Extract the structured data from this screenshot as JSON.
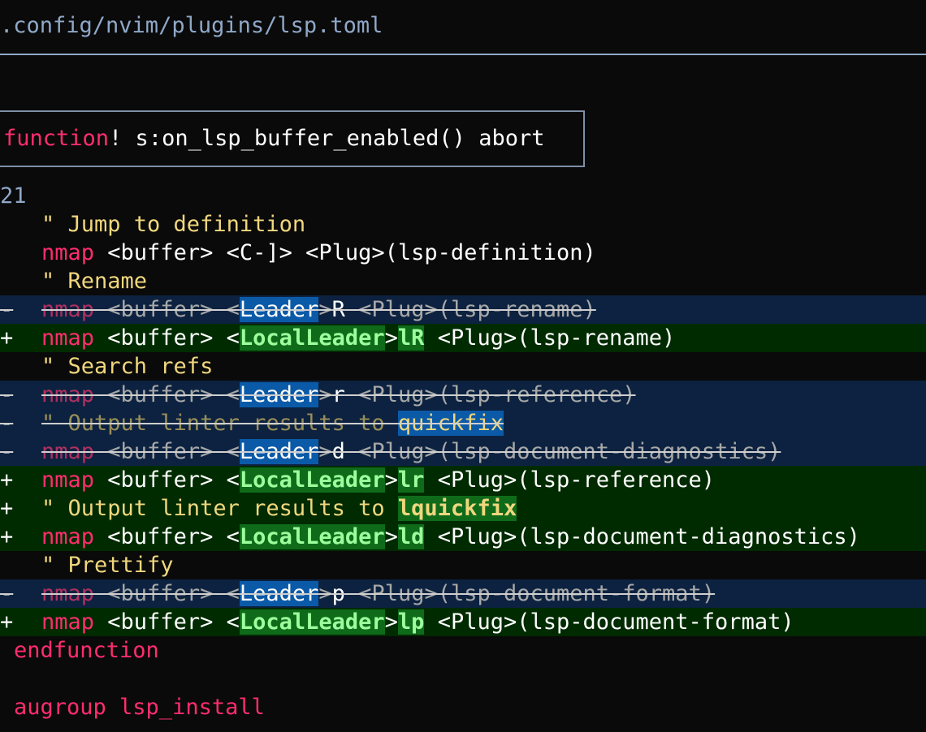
{
  "file_path": ".config/nvim/plugins/lsp.toml",
  "hunk": {
    "keyword": "function",
    "rest": "! s:on_lsp_buffer_enabled() abort"
  },
  "line_number": "21",
  "lines": {
    "l1": {
      "text": "\" Jump to definition"
    },
    "l2": {
      "kw": "nmap",
      "rest": " <buffer> <C-]> <Plug>(lsp-definition)"
    },
    "l3": {
      "text": "\" Rename"
    },
    "d1": {
      "sign": "-",
      "kw": "nmap",
      "pre": " <buffer> <",
      "hl": "Leader",
      "mid": ">",
      "key": "R",
      "post": " <Plug>(lsp-rename)"
    },
    "a1": {
      "sign": "+",
      "kw": "nmap",
      "pre": " <buffer> <",
      "hl": "LocalLeader",
      "mid": ">",
      "key": "lR",
      "post": " <Plug>(lsp-rename)"
    },
    "l4": {
      "text": "\" Search refs"
    },
    "d2": {
      "sign": "-",
      "kw": "nmap",
      "pre": " <buffer> <",
      "hl": "Leader",
      "mid": ">",
      "key": "r",
      "post": " <Plug>(lsp-reference)"
    },
    "d3": {
      "sign": "-",
      "text": "\" Output linter results to ",
      "hl": "quickfix"
    },
    "d4": {
      "sign": "-",
      "kw": "nmap",
      "pre": " <buffer> <",
      "hl": "Leader",
      "mid": ">",
      "key": "d",
      "post": " <Plug>(lsp-document-diagnostics)"
    },
    "a2": {
      "sign": "+",
      "kw": "nmap",
      "pre": " <buffer> <",
      "hl": "LocalLeader",
      "mid": ">",
      "key": "lr",
      "post": " <Plug>(lsp-reference)"
    },
    "a3": {
      "sign": "+",
      "text": "\" Output linter results to ",
      "hl": "lquickfix"
    },
    "a4": {
      "sign": "+",
      "kw": "nmap",
      "pre": " <buffer> <",
      "hl": "LocalLeader",
      "mid": ">",
      "key": "ld",
      "post": " <Plug>(lsp-document-diagnostics)"
    },
    "l5": {
      "text": "\" Prettify"
    },
    "d5": {
      "sign": "-",
      "kw": "nmap",
      "pre": " <buffer> <",
      "hl": "Leader",
      "mid": ">",
      "key": "p",
      "post": " <Plug>(lsp-document-format)"
    },
    "a5": {
      "sign": "+",
      "kw": "nmap",
      "pre": " <buffer> <",
      "hl": "LocalLeader",
      "mid": ">",
      "key": "lp",
      "post": " <Plug>(lsp-document-format)"
    },
    "end": {
      "text": "endfunction"
    },
    "aug": {
      "text": "augroup lsp_install"
    }
  },
  "colors": {
    "background": "#0a0a0a",
    "keyword": "#ff2d6f",
    "comment": "#f0d77e",
    "deleted_bg": "#0c2240",
    "added_bg": "#002b00"
  }
}
